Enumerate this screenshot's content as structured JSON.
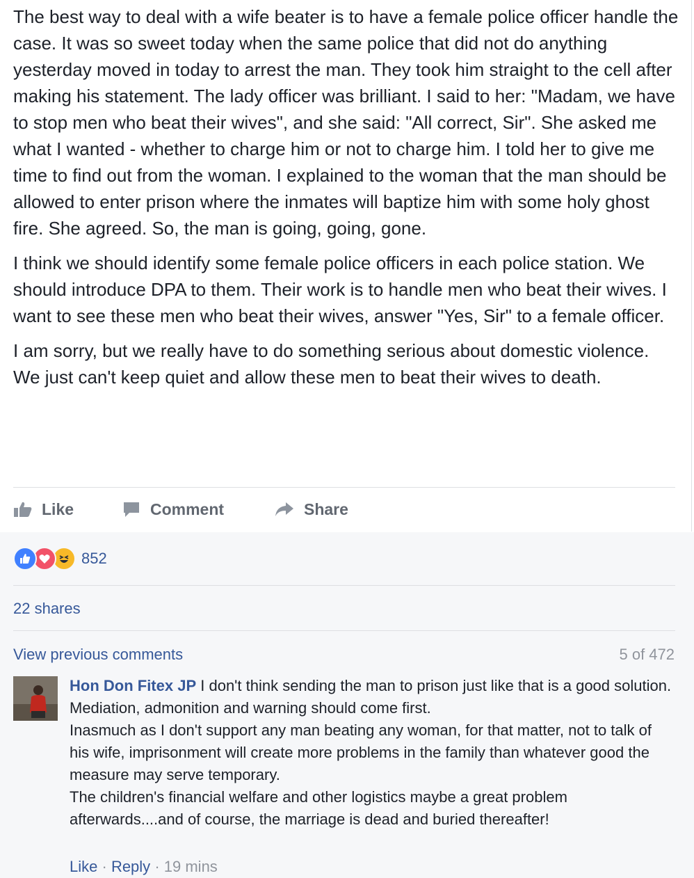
{
  "post": {
    "paragraphs": [
      "The best way to deal with a wife beater is to have a female police officer handle the case. It was so sweet today when the same police that did not do anything yesterday moved in today to arrest the man. They took him straight to the cell after making his statement. The lady officer was brilliant. I said to her: \"Madam, we have to stop men who beat their wives\", and she said: \"All correct, Sir\". She asked me what I wanted - whether to charge him or not to charge him. I told her to give me time to find out from the woman. I explained to the woman that the man should be allowed to enter prison where the inmates will baptize him with some holy ghost fire. She agreed. So, the man is going, going, gone.",
      "I think we should identify some female police officers in each police station. We should introduce DPA to them. Their work is to handle men who beat their wives. I want to see these men who beat their wives, answer \"Yes, Sir\" to a female officer.",
      "I am sorry, but we really have to do something serious about domestic violence. We just can't keep quiet and allow these men to beat their wives to death."
    ]
  },
  "actions": {
    "like": "Like",
    "comment": "Comment",
    "share": "Share"
  },
  "feedback": {
    "reaction_count": "852",
    "shares": "22 shares",
    "view_previous": "View previous comments",
    "paging": "5 of 472"
  },
  "comment": {
    "author": "Hon Don Fitex JP",
    "lines": [
      "I don't think sending the man to prison just like that is a good solution.",
      "Mediation, admonition and warning should come first.",
      "Inasmuch as I don't support any man beating any woman, for that matter, not to talk of his wife, imprisonment will create more problems in the family than whatever good the measure may serve temporary.",
      "The children's financial welfare and other logistics maybe a great problem afterwards....and of course, the marriage is dead and buried thereafter!"
    ],
    "like": "Like",
    "reply": "Reply",
    "sep": "·",
    "time": "19 mins"
  },
  "colors": {
    "link": "#365899",
    "muted": "#90949c",
    "action": "#616770",
    "like_reaction": "#4080ff",
    "love_reaction": "#f25268",
    "haha_reaction": "#f7b928"
  },
  "icons": {
    "like": "thumbs-up-icon",
    "comment": "speech-bubble-icon",
    "share": "share-arrow-icon"
  }
}
